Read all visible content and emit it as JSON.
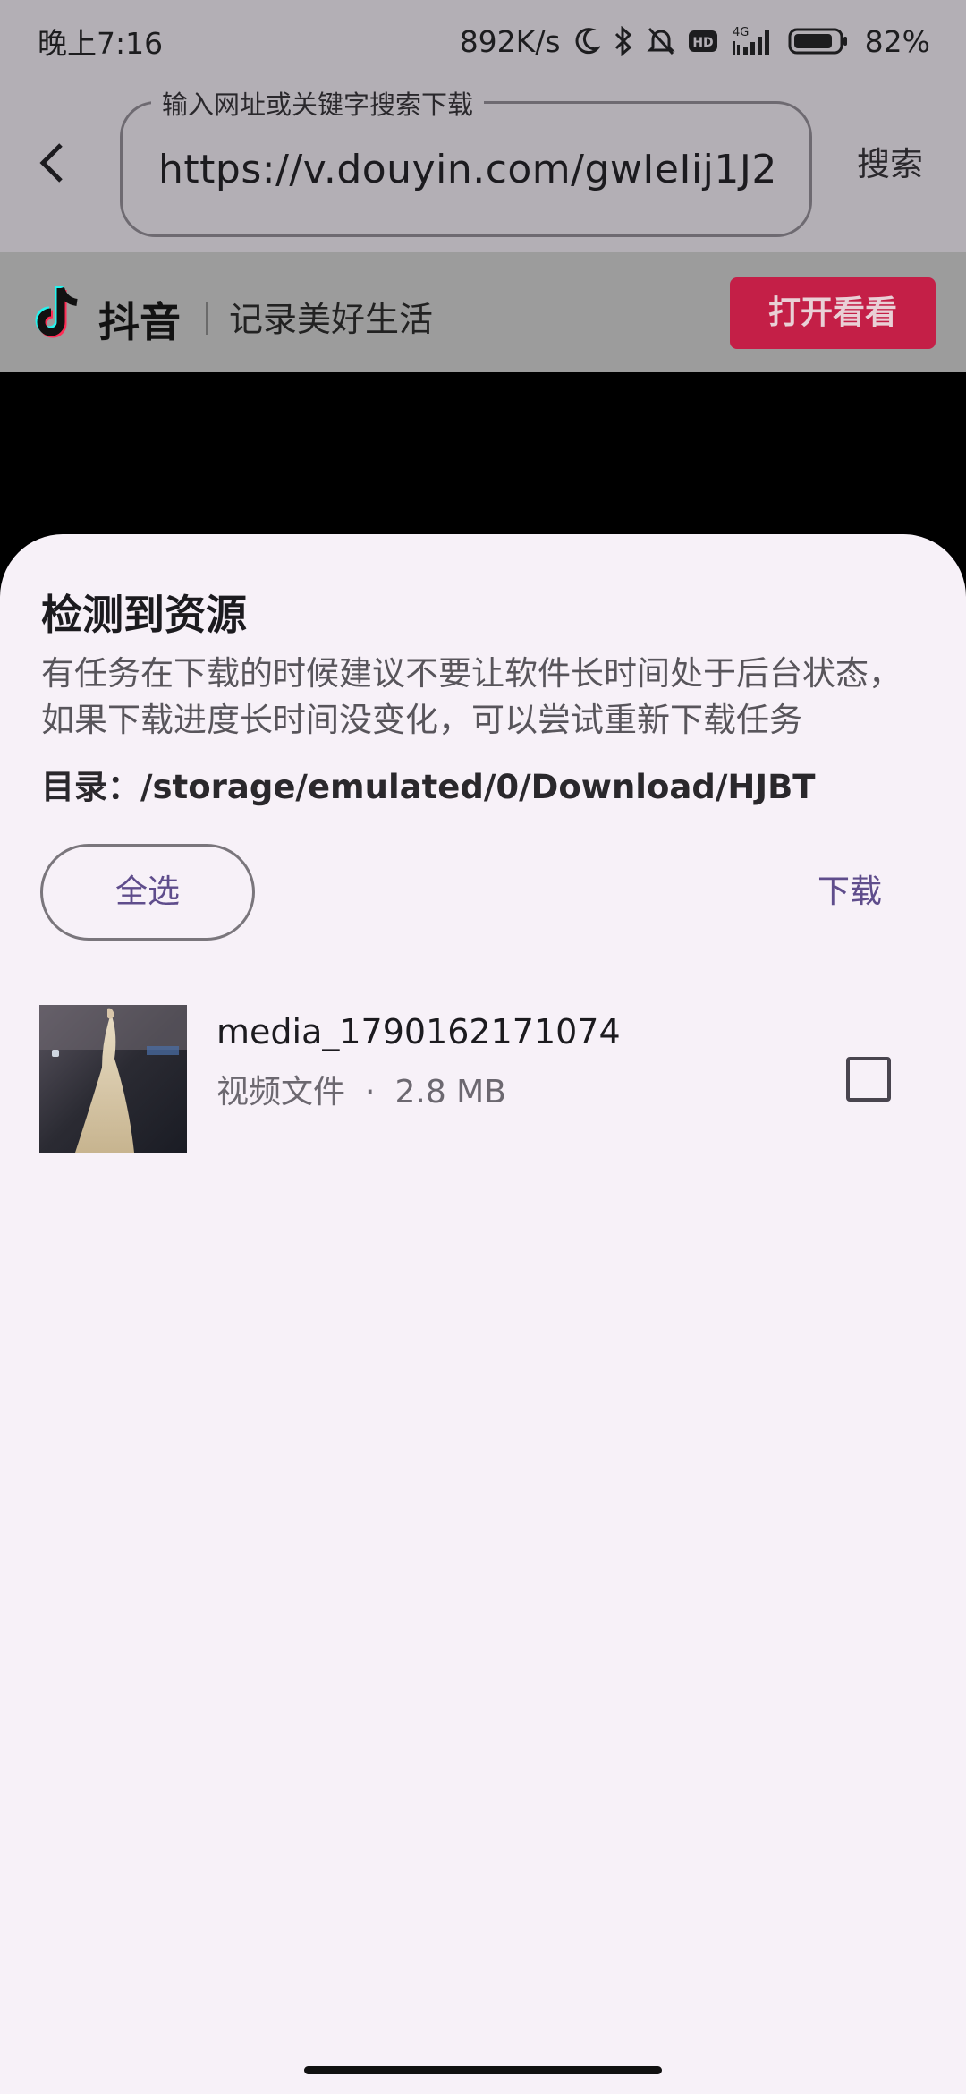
{
  "status_bar": {
    "time": "晚上7:16",
    "net_speed": "892K/s",
    "network_type": "4G",
    "hd_label": "HD",
    "battery": "82%",
    "icons": [
      "moon-icon",
      "bluetooth-icon",
      "bell-muted-icon",
      "hd-icon",
      "signal-icon",
      "battery-icon"
    ]
  },
  "search": {
    "legend": "输入网址或关键字搜索下载",
    "url": "https://v.douyin.com/gwIeIij1J2",
    "button": "搜索"
  },
  "banner": {
    "app_name": "抖音",
    "slogan": "记录美好生活",
    "open_button": "打开看看",
    "accent": "#c41f47"
  },
  "sheet": {
    "title": "检测到资源",
    "description": "有任务在下载的时候建议不要让软件长时间处于后台状态，如果下载进度长时间没变化，可以尝试重新下载任务",
    "directory": "目录：/storage/emulated/0/Download/HJBT",
    "select_all": "全选",
    "download": "下载",
    "accent": "#5f4d8c",
    "items": [
      {
        "name": "media_1790162171074",
        "type": "视频文件",
        "separator": "·",
        "size": "2.8 MB",
        "checked": false
      }
    ]
  }
}
